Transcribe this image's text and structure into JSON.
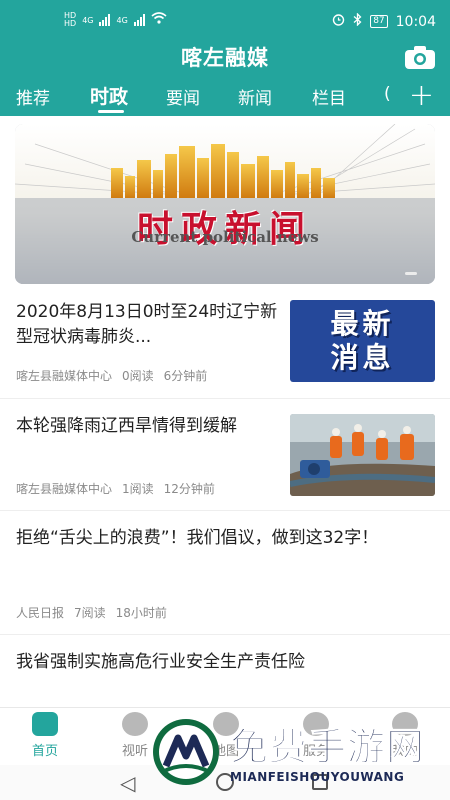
{
  "status_bar": {
    "sim_labels": [
      "HD",
      "HD"
    ],
    "network": [
      "4G",
      "4G"
    ],
    "battery": "87",
    "time": "10:04"
  },
  "header": {
    "title": "喀左融媒",
    "camera_icon": "camera-icon",
    "add_icon": "plus-icon",
    "accent_color": "#23a59d"
  },
  "tabs": [
    {
      "label": "推荐",
      "active": false
    },
    {
      "label": "时政",
      "active": true
    },
    {
      "label": "要闻",
      "active": false
    },
    {
      "label": "新闻",
      "active": false
    },
    {
      "label": "栏目",
      "active": false
    },
    {
      "label": "(",
      "active": false
    }
  ],
  "banner": {
    "title_cn": "时政新闻",
    "title_en": "Current political news"
  },
  "news": [
    {
      "title": "2020年8月13日0时至24时辽宁新型冠状病毒肺炎...",
      "source": "喀左县融媒体中心",
      "reads": "0阅读",
      "time": "6分钟前",
      "thumb_text": [
        "最新",
        "消息"
      ]
    },
    {
      "title": "本轮强降雨辽西旱情得到缓解",
      "source": "喀左县融媒体中心",
      "reads": "1阅读",
      "time": "12分钟前"
    },
    {
      "title": "拒绝“舌尖上的浪费”！我们倡议，做到这32字！",
      "source": "人民日报",
      "reads": "7阅读",
      "time": "18小时前"
    },
    {
      "title": "我省强制实施高危行业安全生产责任险"
    }
  ],
  "bottom_nav": [
    {
      "label": "首页",
      "icon": "home-icon",
      "active": true
    },
    {
      "label": "视听",
      "icon": "play-icon",
      "active": false
    },
    {
      "label": "地图",
      "icon": "map-icon",
      "active": false
    },
    {
      "label": "服务",
      "icon": "handshake-icon",
      "active": false
    },
    {
      "label": "我的",
      "icon": "user-icon",
      "active": false
    }
  ],
  "watermark": {
    "text": "免费手游网",
    "url": "MIANFEISHOUYOUWANG"
  }
}
